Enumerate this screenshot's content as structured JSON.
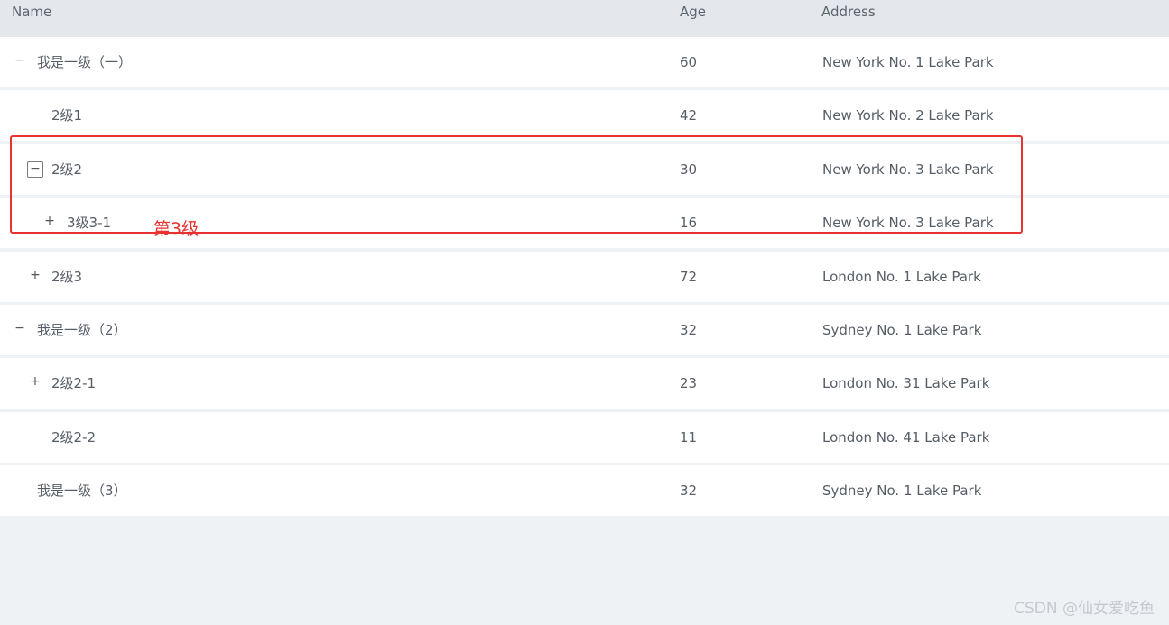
{
  "header": {
    "name": "Name",
    "age": "Age",
    "address": "Address"
  },
  "rows": [
    {
      "name": "我是一级（一）",
      "age": "60",
      "address": "New York No. 1 Lake Park",
      "toggle": "−"
    },
    {
      "name": "2级1",
      "age": "42",
      "address": "New York No. 2 Lake Park",
      "toggle": ""
    },
    {
      "name": "2级2",
      "age": "30",
      "address": "New York No. 3 Lake Park",
      "toggle": "−"
    },
    {
      "name": "3级3-1",
      "age": "16",
      "address": "New York No. 3 Lake Park",
      "toggle": "+"
    },
    {
      "name": "2级3",
      "age": "72",
      "address": "London No. 1 Lake Park",
      "toggle": "+"
    },
    {
      "name": "我是一级（2）",
      "age": "32",
      "address": "Sydney No. 1 Lake Park",
      "toggle": "−"
    },
    {
      "name": "2级2-1",
      "age": "23",
      "address": "London No. 31 Lake Park",
      "toggle": "+"
    },
    {
      "name": "2级2-2",
      "age": "11",
      "address": "London No. 41 Lake Park",
      "toggle": ""
    },
    {
      "name": "我是一级（3）",
      "age": "32",
      "address": "Sydney No. 1 Lake Park",
      "toggle": ""
    }
  ],
  "annotation": "第3级",
  "watermark": "CSDN @仙女爱吃鱼",
  "colors": {
    "highlight": "#e8322f",
    "header_bg": "#e4e8ec",
    "page_bg": "#eff2f5"
  }
}
